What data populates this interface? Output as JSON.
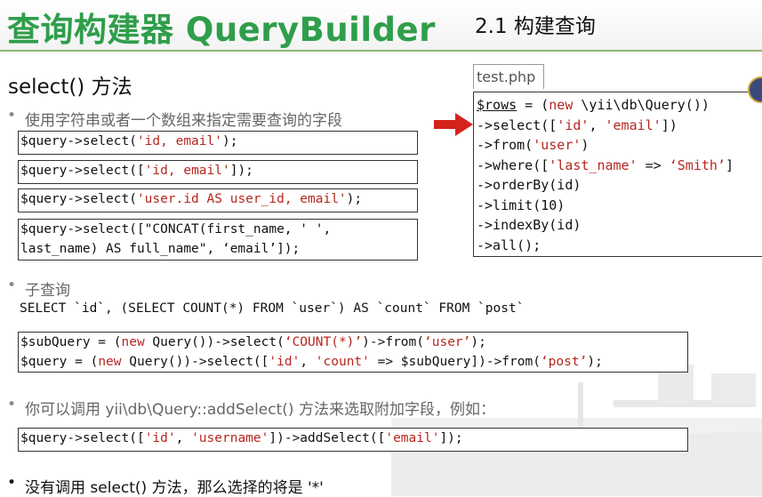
{
  "header": {
    "title": "查询构建器 QueryBuilder",
    "subtitle": "2.1 构建查询"
  },
  "section": {
    "heading": "select() 方法"
  },
  "bullets": {
    "b1": "使用字符串或者一个数组来指定需要查询的字段",
    "b2": "子查询",
    "b3": "你可以调用 yii\\db\\Query::addSelect() 方法来选取附加字段，例如：",
    "b4": "没有调用 select() 方法，那么选择的将是 '*'"
  },
  "code_examples": {
    "ex1": {
      "prefix": "$query->select(",
      "str": "'id, email'",
      "suffix": ");"
    },
    "ex2": {
      "prefix": "$query->select([",
      "str": "'id, email'",
      "suffix": "]);"
    },
    "ex3": {
      "prefix": "$query->select(",
      "str": "'user.id AS user_id, email'",
      "suffix": ");"
    },
    "ex4_line1": "$query->select([\"CONCAT(first_name, ' ',",
    "ex4_line2": "last_name) AS full_name\", ‘email’]);"
  },
  "sql": "SELECT `id`, (SELECT COUNT(*) FROM `user`) AS `count` FROM `post`",
  "subquery_code": {
    "l1_a": "$subQuery = (",
    "l1_new": "new",
    "l1_b": " Query())->select(",
    "l1_str1": "‘COUNT(*)’",
    "l1_c": ")->from(",
    "l1_str2": "‘user’",
    "l1_d": ");",
    "l2_a": "$query = (",
    "l2_new": "new",
    "l2_b": " Query())->select([",
    "l2_str1": "'id'",
    "l2_c": ", ",
    "l2_str2": "'count'",
    "l2_d": " => $subQuery])->from(",
    "l2_str3": "‘post’",
    "l2_e": ");"
  },
  "addselect_code": {
    "a": "$query->select([",
    "s1": "'id'",
    "b": ", ",
    "s2": "'username'",
    "c": "])->addSelect([",
    "s3": "'email'",
    "d": "]);"
  },
  "panel": {
    "file_name": "test.php",
    "l1_var": "$rows",
    "l1_a": " = (",
    "l1_new": "new",
    "l1_b": " \\yii\\db\\Query())",
    "l2_a": "->select([",
    "l2_s1": "'id'",
    "l2_b": ", ",
    "l2_s2": "'email'",
    "l2_c": "])",
    "l3_a": "->from(",
    "l3_s": "'user'",
    "l3_b": ")",
    "l4_a": "->where([",
    "l4_s1": "'last_name'",
    "l4_b": " => ",
    "l4_s2": "‘Smith’",
    "l4_c": "]",
    "l5": "->orderBy(id)",
    "l6": "->limit(10)",
    "l7": "->indexBy(id)",
    "l8": "->all();"
  },
  "colors": {
    "title_green": "#2f9e4b",
    "string_red": "#b5271f",
    "arrow_red": "#d4231b"
  }
}
